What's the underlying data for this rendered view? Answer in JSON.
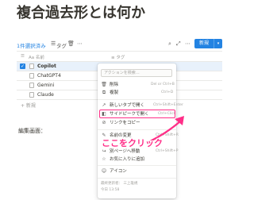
{
  "page": {
    "title": "複合過去形とは何か"
  },
  "toolbar": {
    "selected_count": "1件選択済み",
    "tag_label": "タグ",
    "new_label": "新規"
  },
  "table": {
    "col_name": "Aa 名前",
    "col_tag": "≡ タグ",
    "rows": [
      {
        "name": "Copilot"
      },
      {
        "name": "ChatGPT4"
      },
      {
        "name": "Gemini"
      },
      {
        "name": "Claude"
      }
    ],
    "add_new": "+ 新規"
  },
  "section": {
    "heading": "編集画面："
  },
  "menu": {
    "search_placeholder": "アクションを検索…",
    "items": [
      {
        "label": "削除",
        "shortcut": "Del or Ctrl+B",
        "icon": "trash-icon"
      },
      {
        "label": "複製",
        "shortcut": "Ctrl+D",
        "icon": "duplicate-icon"
      },
      {
        "label": "新しいタブで開く",
        "shortcut": "Ctrl+Shift+Enter",
        "icon": "open-new-tab-icon"
      },
      {
        "label": "サイドピークで開く",
        "shortcut": "Ctrl+Click",
        "icon": "side-peek-icon"
      },
      {
        "label": "リンクをコピー",
        "shortcut": "",
        "icon": "link-icon"
      },
      {
        "label": "名前の変更",
        "shortcut": "Ctrl+Shift+R",
        "icon": "rename-icon"
      },
      {
        "label": "別ページへ移動",
        "shortcut": "Ctrl+Shift+P",
        "icon": "move-icon"
      },
      {
        "label": "お気に入りに追加",
        "shortcut": "",
        "icon": "star-icon"
      },
      {
        "label": "アイコン",
        "shortcut": "",
        "icon": "smiley-icon"
      }
    ],
    "footer_editor": "最終更新者： 三上雄規",
    "footer_time": "今日 13:58"
  },
  "annotation": {
    "text": "ここをクリック",
    "color": "#ff2f88"
  }
}
